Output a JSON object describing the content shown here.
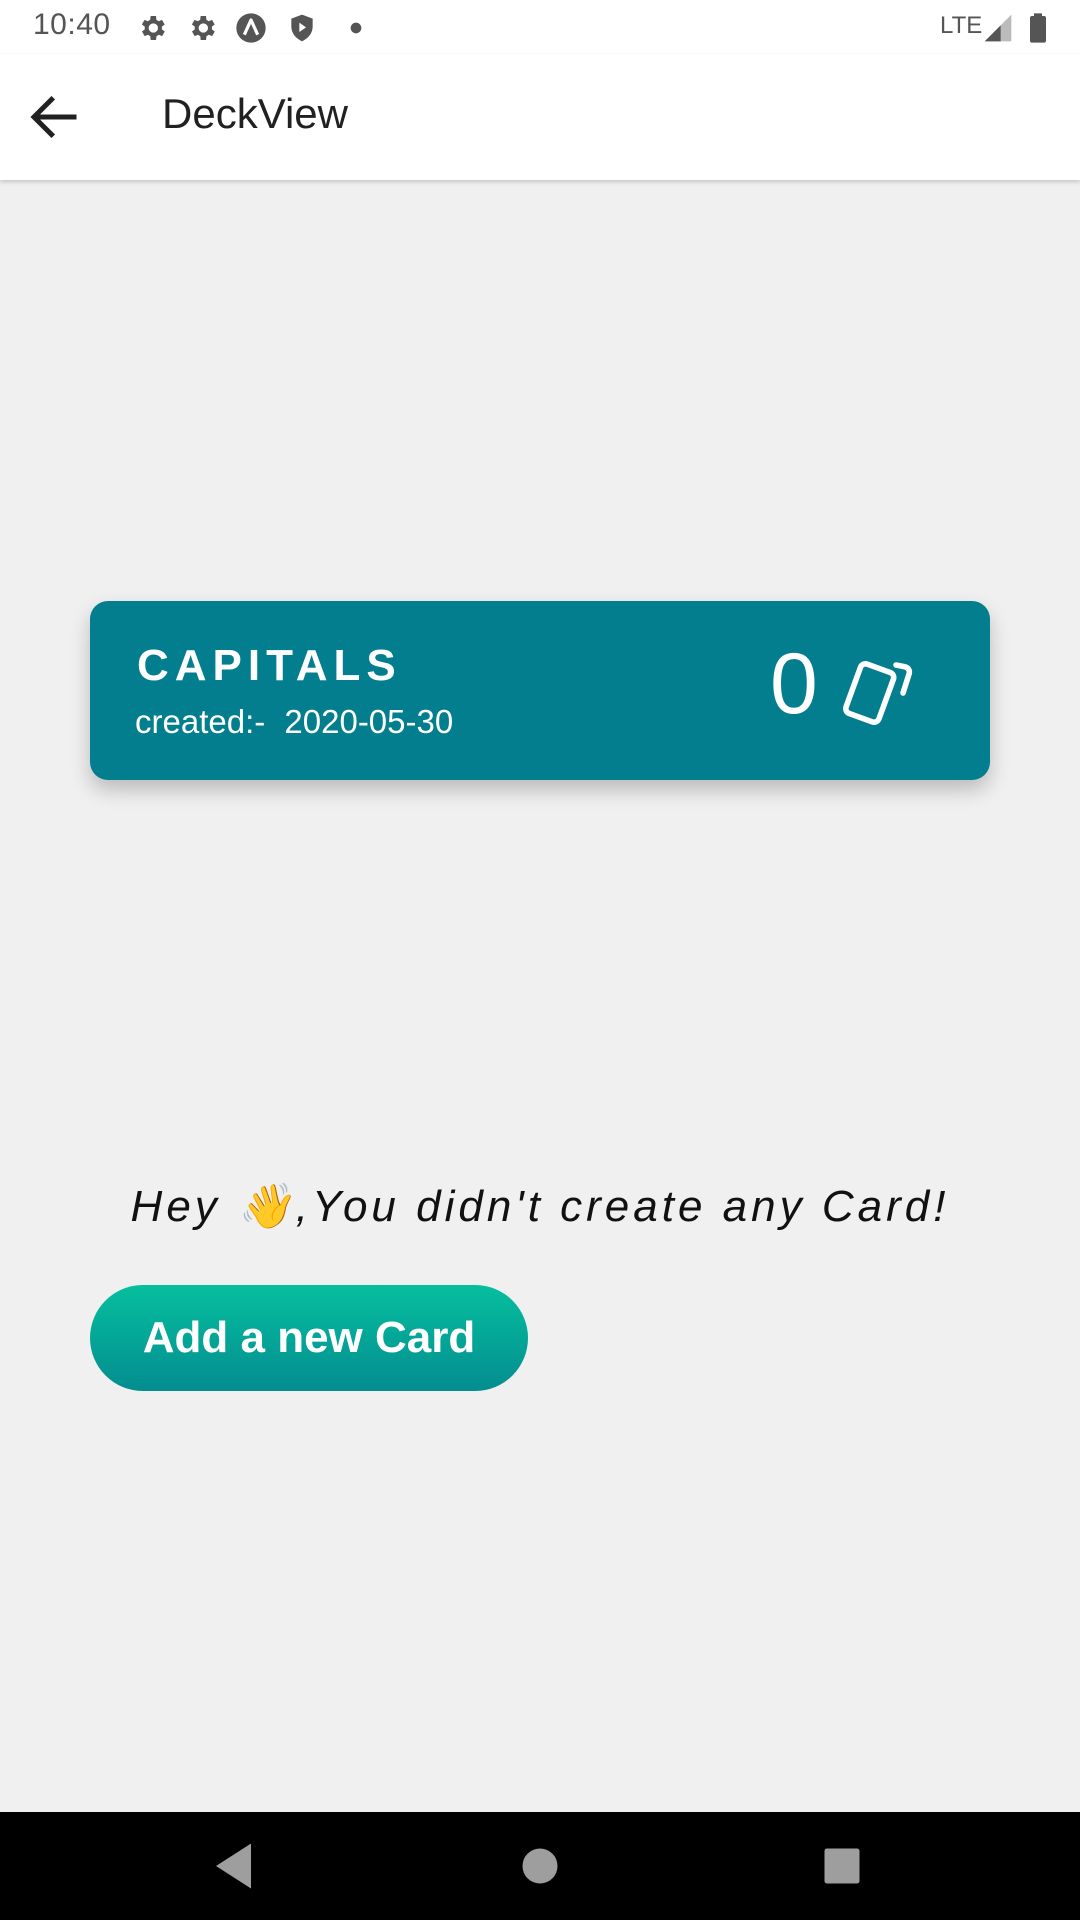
{
  "status_bar": {
    "time": "10:40",
    "network": "LTE",
    "icons": [
      "gear-icon",
      "gear-icon",
      "a-badge-icon",
      "shield-play-icon",
      "dot-icon",
      "signal-icon",
      "battery-icon"
    ]
  },
  "app_bar": {
    "title": "DeckView",
    "back_icon": "arrow-left-icon"
  },
  "deck": {
    "title": "CAPITALS",
    "created_prefix": "created:-",
    "created_date": "2020-05-30",
    "card_count": "0",
    "icon": "cards-icon",
    "color": "#037e8e"
  },
  "empty_state": {
    "message": "Hey 👋,You didn't create any Card!"
  },
  "add_button": {
    "label": "Add a new Card",
    "gradient": [
      "#05bf9e",
      "#048d90"
    ]
  },
  "nav_bar": {
    "icons": [
      "back-triangle-icon",
      "home-circle-icon",
      "recents-square-icon"
    ]
  }
}
